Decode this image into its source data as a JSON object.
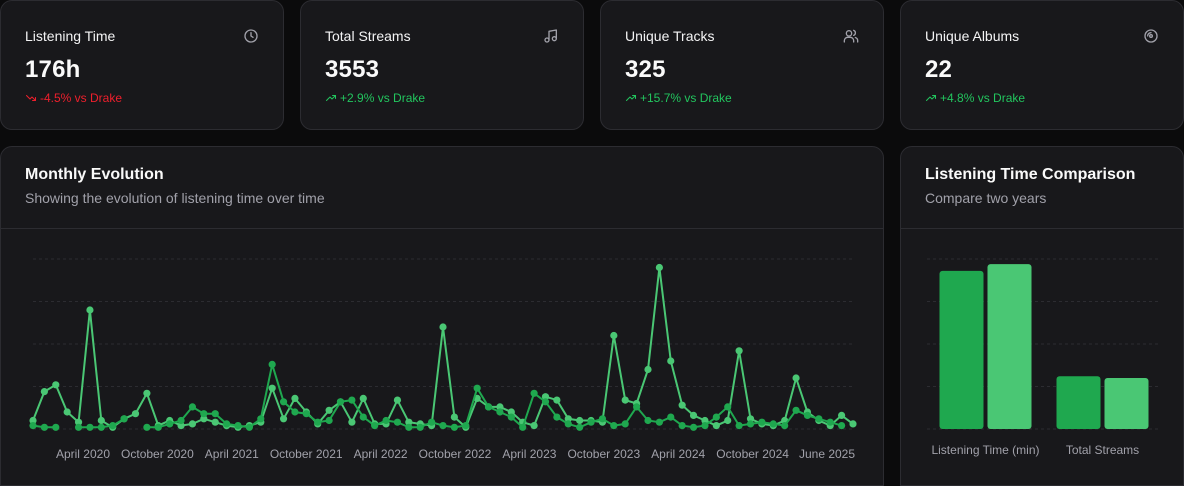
{
  "stats": [
    {
      "title": "Listening Time",
      "value": "176h",
      "delta": "-4.5% vs Drake",
      "trend": "down",
      "icon": "clock-icon"
    },
    {
      "title": "Total Streams",
      "value": "3553",
      "delta": "+2.9% vs Drake",
      "trend": "up",
      "icon": "music-note-icon"
    },
    {
      "title": "Unique Tracks",
      "value": "325",
      "delta": "+15.7% vs Drake",
      "trend": "up",
      "icon": "users-icon"
    },
    {
      "title": "Unique Albums",
      "value": "22",
      "delta": "+4.8% vs Drake",
      "trend": "up",
      "icon": "disc-icon"
    }
  ],
  "colors": {
    "up": "#22c55e",
    "down": "#ef1f2c",
    "series_dark": "#1fa84f",
    "series_light": "#4ac774",
    "grid": "#2c2c31",
    "axis_text": "#a1a1aa"
  },
  "monthly": {
    "title": "Monthly Evolution",
    "subtitle": "Showing the evolution of listening time over time"
  },
  "comparison": {
    "title": "Listening Time Comparison",
    "subtitle": "Compare two years"
  },
  "chart_data": [
    {
      "type": "line",
      "x_tick_labels": [
        "April 2020",
        "October 2020",
        "April 2021",
        "October 2021",
        "April 2022",
        "October 2022",
        "April 2023",
        "October 2023",
        "April 2024",
        "October 2024",
        "June 2025"
      ],
      "x_range": [
        "January 2020",
        "June 2025"
      ],
      "ylim": [
        0,
        100
      ],
      "grid": true,
      "series": [
        {
          "color": "#4ac774",
          "values": [
            5,
            22,
            26,
            10,
            4,
            70,
            5,
            1,
            6,
            9,
            21,
            2,
            5,
            2,
            3,
            6,
            4,
            2,
            1,
            2,
            4,
            24,
            6,
            18,
            10,
            3,
            11,
            16,
            4,
            18,
            3,
            3,
            17,
            4,
            3,
            2,
            60,
            7,
            1,
            18,
            13,
            13,
            10,
            4,
            2,
            19,
            17,
            6,
            5,
            5,
            4,
            55,
            17,
            15,
            35,
            95,
            40,
            14,
            8,
            5,
            2,
            5,
            46,
            6,
            3,
            2,
            5,
            30,
            10,
            5,
            2,
            8,
            3
          ]
        },
        {
          "color": "#1fa84f",
          "values": [
            2,
            1,
            1,
            null,
            1,
            1,
            1,
            2,
            6,
            null,
            1,
            1,
            3,
            5,
            13,
            9,
            9,
            3,
            2,
            1,
            6,
            38,
            16,
            10,
            9,
            4,
            5,
            16,
            17,
            7,
            2,
            5,
            4,
            1,
            1,
            4,
            2,
            1,
            2,
            24,
            13,
            10,
            7,
            1,
            21,
            16,
            7,
            3,
            1,
            4,
            6,
            2,
            3,
            13,
            5,
            4,
            7,
            2,
            1,
            2,
            7,
            13,
            2,
            3,
            4,
            3,
            2,
            11,
            8,
            6,
            4,
            2
          ]
        }
      ]
    },
    {
      "type": "bar",
      "categories": [
        "Listening Time (min)",
        "Total Streams"
      ],
      "ylim": [
        0,
        100
      ],
      "grid": true,
      "series": [
        {
          "color": "#1fa84f",
          "values": [
            93,
            31
          ]
        },
        {
          "color": "#4ac774",
          "values": [
            97,
            30
          ]
        }
      ]
    }
  ]
}
